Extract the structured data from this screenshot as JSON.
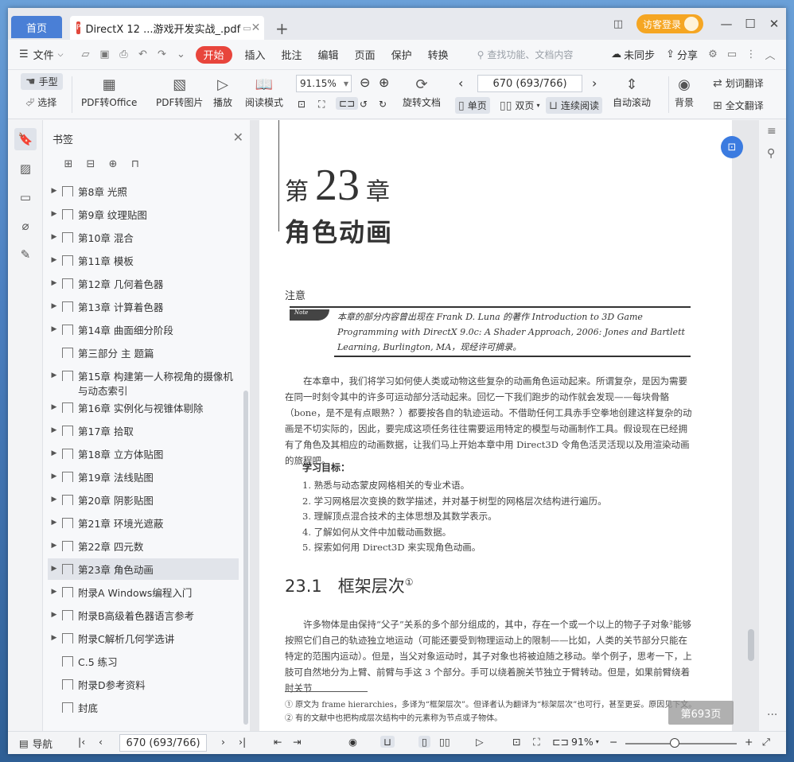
{
  "titlebar": {
    "home_tab": "首页",
    "doc_tab": "DirectX 12 ...游戏开发实战_.pdf",
    "new_tab": "+",
    "login": "访客登录"
  },
  "menu": {
    "file": "文件",
    "items": [
      "开始",
      "插入",
      "批注",
      "编辑",
      "页面",
      "保护",
      "转换"
    ],
    "search_placeholder": "查找功能、文档内容",
    "sync": "未同步",
    "share": "分享"
  },
  "ribbon": {
    "hand": "手型",
    "select": "选择",
    "pdf_office": "PDF转Office",
    "pdf_image": "PDF转图片",
    "play": "播放",
    "read_mode": "阅读模式",
    "zoom": "91.15%",
    "rotate": "旋转文档",
    "page_box": "670 (693/766)",
    "single": "单页",
    "double": "双页",
    "continuous": "连续阅读",
    "auto_scroll": "自动滚动",
    "background": "背景",
    "word_translate": "划词翻译",
    "full_translate": "全文翻译"
  },
  "panel": {
    "title": "书签",
    "bookmarks": [
      {
        "label": "第8章 光照",
        "expand": true
      },
      {
        "label": "第9章 纹理贴图",
        "expand": true
      },
      {
        "label": "第10章 混合",
        "expand": true
      },
      {
        "label": "第11章 模板",
        "expand": true
      },
      {
        "label": "第12章 几何着色器",
        "expand": true
      },
      {
        "label": "第13章 计算着色器",
        "expand": true
      },
      {
        "label": "第14章 曲面细分阶段",
        "expand": true
      },
      {
        "label": "第三部分 主 题篇",
        "expand": false
      },
      {
        "label": "第15章 构建第一人称视角的摄像机",
        "label2": "与动态索引",
        "expand": true
      },
      {
        "label": "第16章 实例化与视锥体剔除",
        "expand": true
      },
      {
        "label": "第17章 拾取",
        "expand": true
      },
      {
        "label": "第18章 立方体贴图",
        "expand": true
      },
      {
        "label": "第19章 法线贴图",
        "expand": true
      },
      {
        "label": "第20章 阴影贴图",
        "expand": true
      },
      {
        "label": "第21章 环境光遮蔽",
        "expand": true
      },
      {
        "label": "第22章 四元数",
        "expand": true
      },
      {
        "label": "第23章 角色动画",
        "expand": true,
        "selected": true
      },
      {
        "label": "附录A Windows编程入门",
        "expand": true
      },
      {
        "label": "附录B高级着色器语言参考",
        "expand": true
      },
      {
        "label": "附录C解析几何学选讲",
        "expand": true
      },
      {
        "label": "C.5 练习",
        "expand": false
      },
      {
        "label": "附录D参考资料",
        "expand": false
      },
      {
        "label": "封底",
        "expand": false
      }
    ]
  },
  "page": {
    "chapter_pre": "第",
    "chapter_num": "23",
    "chapter_suf": "章",
    "chapter_title": "角色动画",
    "note_head": "注意",
    "note_tag": "Note",
    "note_text": "本章的部分内容曾出现在 Frank D. Luna 的著作 Introduction to 3D Game Programming with DirectX 9.0c: A Shader Approach, 2006: Jones and Bartlett Learning, Burlington, MA，现经许可摘录。",
    "intro": "在本章中，我们将学习如何使人类或动物这些复杂的动画角色运动起来。所谓复杂，是因为需要在同一时刻令其中的许多可运动部分活动起来。回忆一下我们跑步的动作就会发现——每块骨骼（bone，是不是有点眼熟？）都要按各自的轨迹运动。不借助任何工具赤手空拳地创建这样复杂的动画是不切实际的，因此，要完成这项任务往往需要运用特定的模型与动画制作工具。假设现在已经拥有了角色及其相应的动画数据，让我们马上开始本章中用 Direct3D 令角色活灵活现以及用渲染动画的旅程吧。",
    "goals_head": "学习目标：",
    "goals": [
      "1.  熟悉与动态蒙皮网格相关的专业术语。",
      "2.  学习网格层次变换的数学描述，并对基于树型的网格层次结构进行遍历。",
      "3.  理解顶点混合技术的主体思想及其数学表示。",
      "4.  了解如何从文件中加载动画数据。",
      "5.  探索如何用 Direct3D 来实现角色动画。"
    ],
    "section_num": "23.1",
    "section_title": "框架层次",
    "section_sup": "①",
    "body": "许多物体是由保持“父子”关系的多个部分组成的，其中，存在一个或一个以上的物子子对象²能够按照它们自己的轨迹独立地运动（可能还要受到物理运动上的限制——比如，人类的关节部分只能在特定的范围内运动）。但是，当父对象运动时，其子对象也将被迫随之移动。举个例子，思考一下，上肢可自然地分为上臂、前臂与手这 3 个部分。手可以绕着腕关节独立于臂转动。但是，如果前臂绕着肘关节",
    "footnote1": "① 原文为 frame hierarchies，多译为“框架层次”。但译者认为翻译为“标架层次”也可行，甚至更妥。原因见下文。",
    "footnote2": "② 有的文献中也把构成层次结构中的元素称为节点或子物体。",
    "badge": "第693页"
  },
  "status": {
    "nav": "导航",
    "page_box": "670 (693/766)",
    "zoom": "91%"
  }
}
